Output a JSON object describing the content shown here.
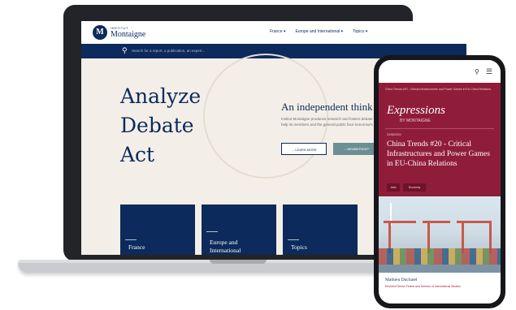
{
  "site": {
    "logo_small": "INSTITUT",
    "logo_text": "Montaigne",
    "logo_mark": "M",
    "nav_links": [
      "France ▾",
      "Europe and International ▾",
      "Topics ▾"
    ],
    "search_placeholder": "Search for a report, a publication, an expert..."
  },
  "hero": {
    "lines": [
      "Analyze",
      "Debate",
      "Act"
    ],
    "tagline": "An independent think tank,",
    "blurb": "Institut Montaigne produces research and fosters debate on public policy to help its members and the general public face tomorrow's challenges",
    "buttons": {
      "learn_more": "→ LEARN MORE",
      "membership": "→ MEMBERSHIP",
      "extra": "→"
    }
  },
  "tiles": [
    "France",
    "Europe and International",
    "Topics"
  ],
  "phone": {
    "breadcrumb": "China Trends #20 - Critical Infrastructures and Power Games in EU-China Relations",
    "series": "Expressions",
    "byline": "BY MONTAIGNE",
    "date": "24/06/2024",
    "title": "China Trends #20 - Critical Infrastructures and Power Games in EU-China Relations",
    "tags": [
      "Asia",
      "Economy"
    ],
    "author": "Mathieu Duchatel",
    "author_role": "Resident Senior Fellow and Director of International Studies"
  },
  "colors": {
    "navy": "#0c2a5b",
    "burgundy": "#8f1d3a",
    "teal": "#6b8f92",
    "cream": "#f3efe8"
  }
}
